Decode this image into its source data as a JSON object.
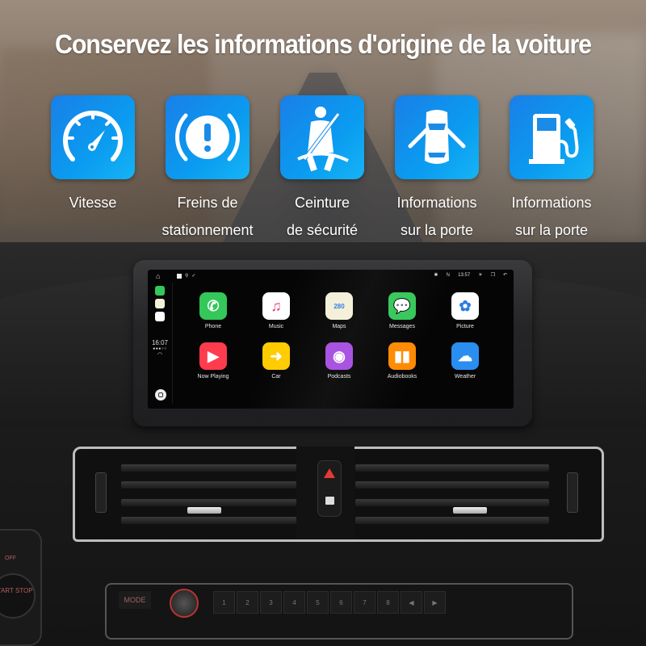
{
  "headline": "Conservez les informations d'origine de la voiture",
  "features": [
    {
      "icon": "speedometer-icon",
      "line1": "Vitesse",
      "line2": ""
    },
    {
      "icon": "parking-brake-icon",
      "line1": "Freins de",
      "line2": "stationnement"
    },
    {
      "icon": "seatbelt-icon",
      "line1": "Ceinture",
      "line2": "de sécurité"
    },
    {
      "icon": "car-doors-icon",
      "line1": "Informations",
      "line2": "sur la porte"
    },
    {
      "icon": "fuel-pump-icon",
      "line1": "Informations",
      "line2": "sur la porte"
    }
  ],
  "screen": {
    "status_bar": {
      "time": "13:57",
      "bt": "✱",
      "signal": "ℕ"
    },
    "sidebar": {
      "clock": "16:07",
      "dots": "●●●○○"
    },
    "apps": [
      {
        "name": "Phone",
        "icon": "phone-icon",
        "color": "#34c759",
        "glyph": "✆"
      },
      {
        "name": "Music",
        "icon": "music-icon",
        "color": "#ffffff",
        "glyph": "♫"
      },
      {
        "name": "Maps",
        "icon": "maps-icon",
        "color": "#f4efd8",
        "glyph": "280"
      },
      {
        "name": "Messages",
        "icon": "messages-icon",
        "color": "#34c759",
        "glyph": "💬"
      },
      {
        "name": "Picture",
        "icon": "photos-icon",
        "color": "#ffffff",
        "glyph": "✿"
      },
      {
        "name": "Now Playing",
        "icon": "now-playing-icon",
        "color": "#ff3b4e",
        "glyph": "▶"
      },
      {
        "name": "Car",
        "icon": "car-icon",
        "color": "#ffcc00",
        "glyph": "➜"
      },
      {
        "name": "Podcasts",
        "icon": "podcasts-icon",
        "color": "#a44ce0",
        "glyph": "◉"
      },
      {
        "name": "Audiobooks",
        "icon": "audiobooks-icon",
        "color": "#ff8a00",
        "glyph": "▮▮"
      },
      {
        "name": "Weather",
        "icon": "weather-icon",
        "color": "#2a8ef0",
        "glyph": "☁"
      }
    ]
  },
  "console": {
    "mode_label": "MODE",
    "presets": [
      "1",
      "2",
      "3",
      "4",
      "5",
      "6",
      "7",
      "8",
      "◀",
      "▶"
    ],
    "start_label": "START STOP",
    "off_label": "OFF"
  }
}
